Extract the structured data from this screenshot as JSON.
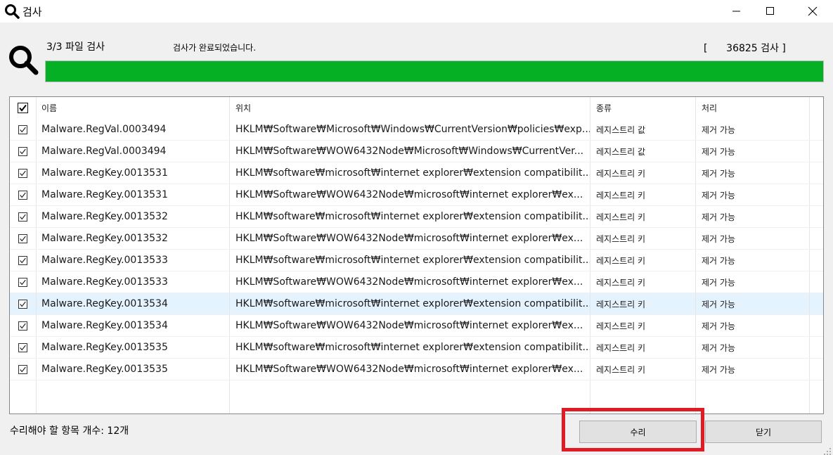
{
  "window": {
    "title": "검사",
    "controls": [
      "minimize",
      "maximize",
      "close"
    ]
  },
  "header": {
    "file_count": "3/3 파일 검사",
    "status_message": "검사가 완료되었습니다.",
    "scan_count": "[      36825 검사 ]",
    "progress": 1.0,
    "progress_color": "#06b025"
  },
  "list": {
    "columns": [
      "",
      "이름",
      "위치",
      "종류",
      "처리"
    ],
    "header_checked": true,
    "rows": [
      {
        "checked": true,
        "name": "Malware.RegVal.0003494",
        "location": "HKLM₩Software₩Microsoft₩Windows₩CurrentVersion₩policies₩exp...",
        "type": "레지스트리 값",
        "action": "제거 가능"
      },
      {
        "checked": true,
        "name": "Malware.RegVal.0003494",
        "location": "HKLM₩Software₩WOW6432Node₩Microsoft₩Windows₩CurrentVer...",
        "type": "레지스트리 값",
        "action": "제거 가능"
      },
      {
        "checked": true,
        "name": "Malware.RegKey.0013531",
        "location": "HKLM₩software₩microsoft₩internet explorer₩extension compatibilit...",
        "type": "레지스트리 키",
        "action": "제거 가능"
      },
      {
        "checked": true,
        "name": "Malware.RegKey.0013531",
        "location": "HKLM₩Software₩WOW6432Node₩microsoft₩internet explorer₩ex...",
        "type": "레지스트리 키",
        "action": "제거 가능"
      },
      {
        "checked": true,
        "name": "Malware.RegKey.0013532",
        "location": "HKLM₩software₩microsoft₩internet explorer₩extension compatibilit...",
        "type": "레지스트리 키",
        "action": "제거 가능"
      },
      {
        "checked": true,
        "name": "Malware.RegKey.0013532",
        "location": "HKLM₩Software₩WOW6432Node₩microsoft₩internet explorer₩ex...",
        "type": "레지스트리 키",
        "action": "제거 가능"
      },
      {
        "checked": true,
        "name": "Malware.RegKey.0013533",
        "location": "HKLM₩software₩microsoft₩internet explorer₩extension compatibilit...",
        "type": "레지스트리 키",
        "action": "제거 가능"
      },
      {
        "checked": true,
        "name": "Malware.RegKey.0013533",
        "location": "HKLM₩Software₩WOW6432Node₩microsoft₩internet explorer₩ex...",
        "type": "레지스트리 키",
        "action": "제거 가능"
      },
      {
        "checked": true,
        "name": "Malware.RegKey.0013534",
        "location": "HKLM₩software₩microsoft₩internet explorer₩extension compatibilit...",
        "type": "레지스트리 키",
        "action": "제거 가능",
        "selected": true
      },
      {
        "checked": true,
        "name": "Malware.RegKey.0013534",
        "location": "HKLM₩Software₩WOW6432Node₩microsoft₩internet explorer₩ex...",
        "type": "레지스트리 키",
        "action": "제거 가능"
      },
      {
        "checked": true,
        "name": "Malware.RegKey.0013535",
        "location": "HKLM₩software₩microsoft₩internet explorer₩extension compatibilit...",
        "type": "레지스트리 키",
        "action": "제거 가능"
      },
      {
        "checked": true,
        "name": "Malware.RegKey.0013535",
        "location": "HKLM₩Software₩WOW6432Node₩microsoft₩internet explorer₩ex...",
        "type": "레지스트리 키",
        "action": "제거 가능"
      }
    ]
  },
  "footer": {
    "items_to_repair": "수리해야 할 항목 개수: 12개",
    "repair_label": "수리",
    "close_label": "닫기",
    "highlight_color": "#e01b24"
  },
  "icons": {
    "title": "search-icon",
    "header": "magnifier-icon",
    "checkbox": "checkmark-icon"
  }
}
